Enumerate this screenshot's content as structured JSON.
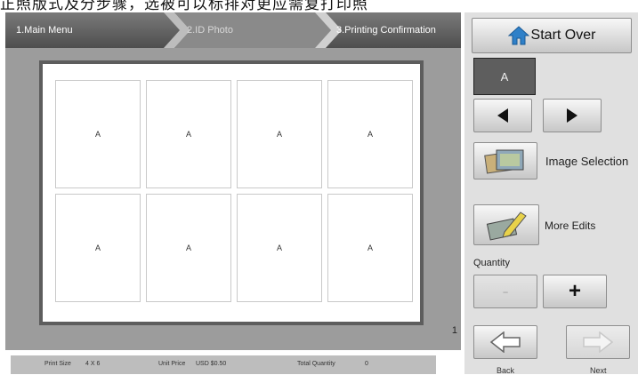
{
  "caption": "正照版式及分步骤，选被可以标排对更应需复打印照",
  "breadcrumb": [
    {
      "label": "1.Main Menu"
    },
    {
      "label": "2.ID Photo"
    },
    {
      "label": "3.Printing Confirmation"
    }
  ],
  "sheet": {
    "photos": [
      "A",
      "A",
      "A",
      "A",
      "A",
      "A",
      "A",
      "A"
    ],
    "page_number": "1"
  },
  "status": {
    "print_size_label": "Print Size",
    "print_size_value": "4 X 6",
    "unit_price_label": "Unit Price",
    "unit_price_value": "USD $0.50",
    "total_quantity_label": "Total Quantity",
    "total_quantity_value": "0"
  },
  "panel": {
    "start_over": "Start Over",
    "selected_tile": "A",
    "image_selection": "Image Selection",
    "more_edits": "More Edits",
    "quantity_label": "Quantity",
    "minus": "-",
    "plus": "+",
    "back": "Back",
    "next": "Next"
  },
  "icons": {
    "start_over": "home-icon",
    "prev": "triangle-left-icon",
    "next": "triangle-right-icon",
    "image_selection": "photos-icon",
    "more_edits": "edit-pen-icon",
    "back": "arrow-left-icon",
    "next_step": "arrow-right-icon"
  },
  "colors": {
    "breadcrumb_bg": "#5e5e5e",
    "work_area_bg": "#9c9c9c",
    "panel_bg": "#e0e0e0",
    "tile_bg": "#5e5e5e"
  }
}
